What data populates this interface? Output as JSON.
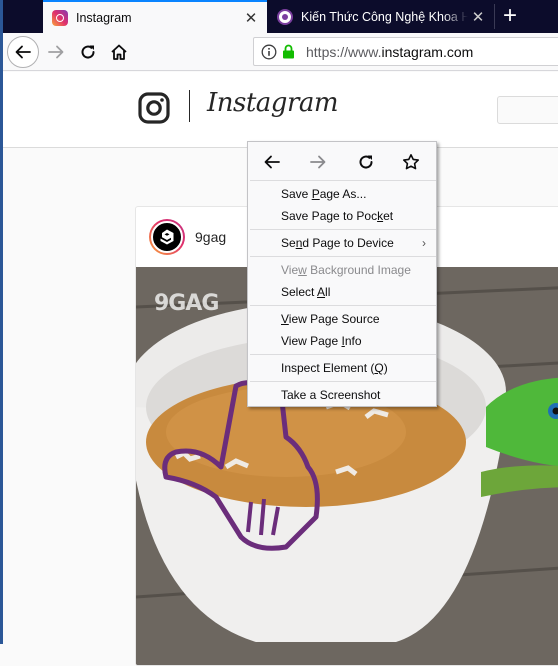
{
  "browser": {
    "tabs": [
      {
        "title": "Instagram",
        "active": true,
        "favicon": "instagram-icon",
        "close_icon": "✕"
      },
      {
        "title": "Kiến Thức Công Nghệ Khoa Học",
        "active": false,
        "favicon": "quantrimang-icon",
        "close_icon": "✕"
      }
    ],
    "new_tab_icon": "+",
    "nav": {
      "back_icon": "back-arrow-icon",
      "forward_icon": "forward-arrow-icon",
      "reload_icon": "reload-icon",
      "home_icon": "home-icon"
    },
    "urlbar": {
      "info_icon": "info-icon",
      "lock_icon": "lock-icon",
      "url_prefix": "https://www.",
      "url_host": "instagram.com"
    }
  },
  "page": {
    "header": {
      "wordmark": "Instagram"
    },
    "post": {
      "username": "9gag",
      "watermark": "9GAG"
    }
  },
  "context_menu": {
    "nav_icons": [
      "back",
      "forward",
      "reload",
      "bookmark-star"
    ],
    "groups": [
      [
        {
          "pre": "Save ",
          "u": "P",
          "post": "age As...",
          "disabled": false
        },
        {
          "pre": "Save Page to Poc",
          "u": "k",
          "post": "et",
          "disabled": false
        }
      ],
      [
        {
          "pre": "Se",
          "u": "n",
          "post": "d Page to Device",
          "disabled": false,
          "submenu": "›"
        }
      ],
      [
        {
          "pre": "Vie",
          "u": "w",
          "post": " Background Image",
          "disabled": true
        },
        {
          "pre": "Select ",
          "u": "A",
          "post": "ll",
          "disabled": false
        }
      ],
      [
        {
          "pre": "",
          "u": "V",
          "post": "iew Page Source",
          "disabled": false
        },
        {
          "pre": "View Page ",
          "u": "I",
          "post": "nfo",
          "disabled": false
        }
      ],
      [
        {
          "pre": "Inspect Element (",
          "u": "Q",
          "post": ")",
          "disabled": false
        }
      ],
      [
        {
          "pre": "Take a Screenshot",
          "u": "",
          "post": "",
          "disabled": false
        }
      ]
    ]
  },
  "colors": {
    "tabstrip_bg": "#0c0c2b",
    "active_tab_accent": "#0a84ff",
    "lock_green": "#12bc00",
    "annotation_purple": "#6b2d7b"
  }
}
